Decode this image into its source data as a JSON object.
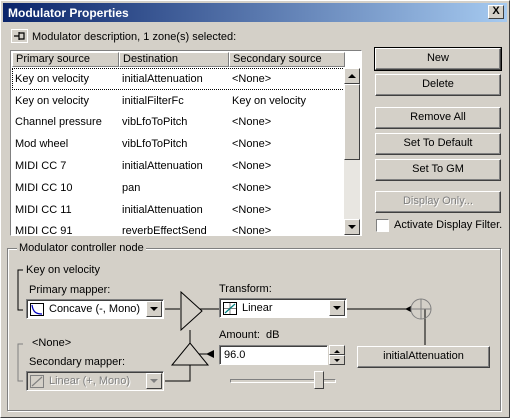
{
  "window": {
    "title": "Modulator Properties",
    "close_label": "X"
  },
  "description": "Modulator description, 1 zone(s) selected:",
  "list": {
    "columns": [
      "Primary source",
      "Destination",
      "Secondary source"
    ],
    "rows": [
      [
        "Key on velocity",
        "initialAttenuation",
        "<None>"
      ],
      [
        "Key on velocity",
        "initialFilterFc",
        "Key on velocity"
      ],
      [
        "Channel pressure",
        "vibLfoToPitch",
        "<None>"
      ],
      [
        "Mod wheel",
        "vibLfoToPitch",
        "<None>"
      ],
      [
        "MIDI CC 7",
        "initialAttenuation",
        "<None>"
      ],
      [
        "MIDI CC 10",
        "pan",
        "<None>"
      ],
      [
        "MIDI CC 11",
        "initialAttenuation",
        "<None>"
      ],
      [
        "MIDI CC 91",
        "reverbEffectSend",
        "<None>"
      ]
    ],
    "selected_index": 0
  },
  "buttons": {
    "new": "New",
    "delete": "Delete",
    "remove_all": "Remove All",
    "set_default": "Set To Default",
    "set_gm": "Set To GM",
    "display_only": "Display Only..."
  },
  "filter_checkbox": {
    "label": "Activate Display Filter.",
    "checked": false
  },
  "node": {
    "group_title": "Modulator controller node",
    "primary_source": "Key on velocity",
    "primary_mapper_label": "Primary mapper:",
    "primary_mapper_value": "Concave (-, Mono)",
    "secondary_source": "<None>",
    "secondary_mapper_label": "Secondary mapper:",
    "secondary_mapper_value": "Linear (+, Mono)",
    "transform_label": "Transform:",
    "transform_value": "Linear",
    "amount_label": "Amount:",
    "amount_unit": "dB",
    "amount_value": "96.0",
    "destination_button": "initialAttenuation",
    "slider_level": 0.88
  },
  "icons": {
    "pin": "pin-icon",
    "concave": "concave-curve-icon",
    "linear": "linear-curve-icon",
    "transform": "linear-transform-icon"
  },
  "colors": {
    "titlebar_start": "#0a246a",
    "titlebar_end": "#a6caf0",
    "face": "#d4d0c8"
  }
}
